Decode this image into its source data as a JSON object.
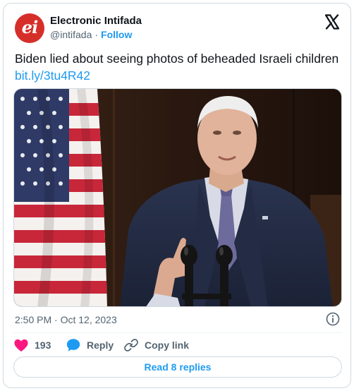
{
  "author": {
    "avatar_text": "ei",
    "name": "Electronic Intifada",
    "handle": "@intifada",
    "separator": "·",
    "follow_label": "Follow"
  },
  "tweet": {
    "text": "Biden lied about seeing photos of beheaded Israeli children",
    "link": "bit.ly/3tu4R42",
    "timestamp": "2:50 PM · Oct 12, 2023"
  },
  "actions": {
    "likes": "193",
    "reply_label": "Reply",
    "copy_label": "Copy link",
    "read_replies_label": "Read 8 replies"
  },
  "icons": {
    "x_logo": "x-logo-icon",
    "info": "info-icon",
    "like": "heart-icon",
    "reply": "reply-bubble-icon",
    "copy": "link-icon"
  },
  "colors": {
    "accent": "#1d9bf0",
    "heart": "#f91880",
    "avatar": "#d62f2a",
    "muted": "#536471"
  }
}
